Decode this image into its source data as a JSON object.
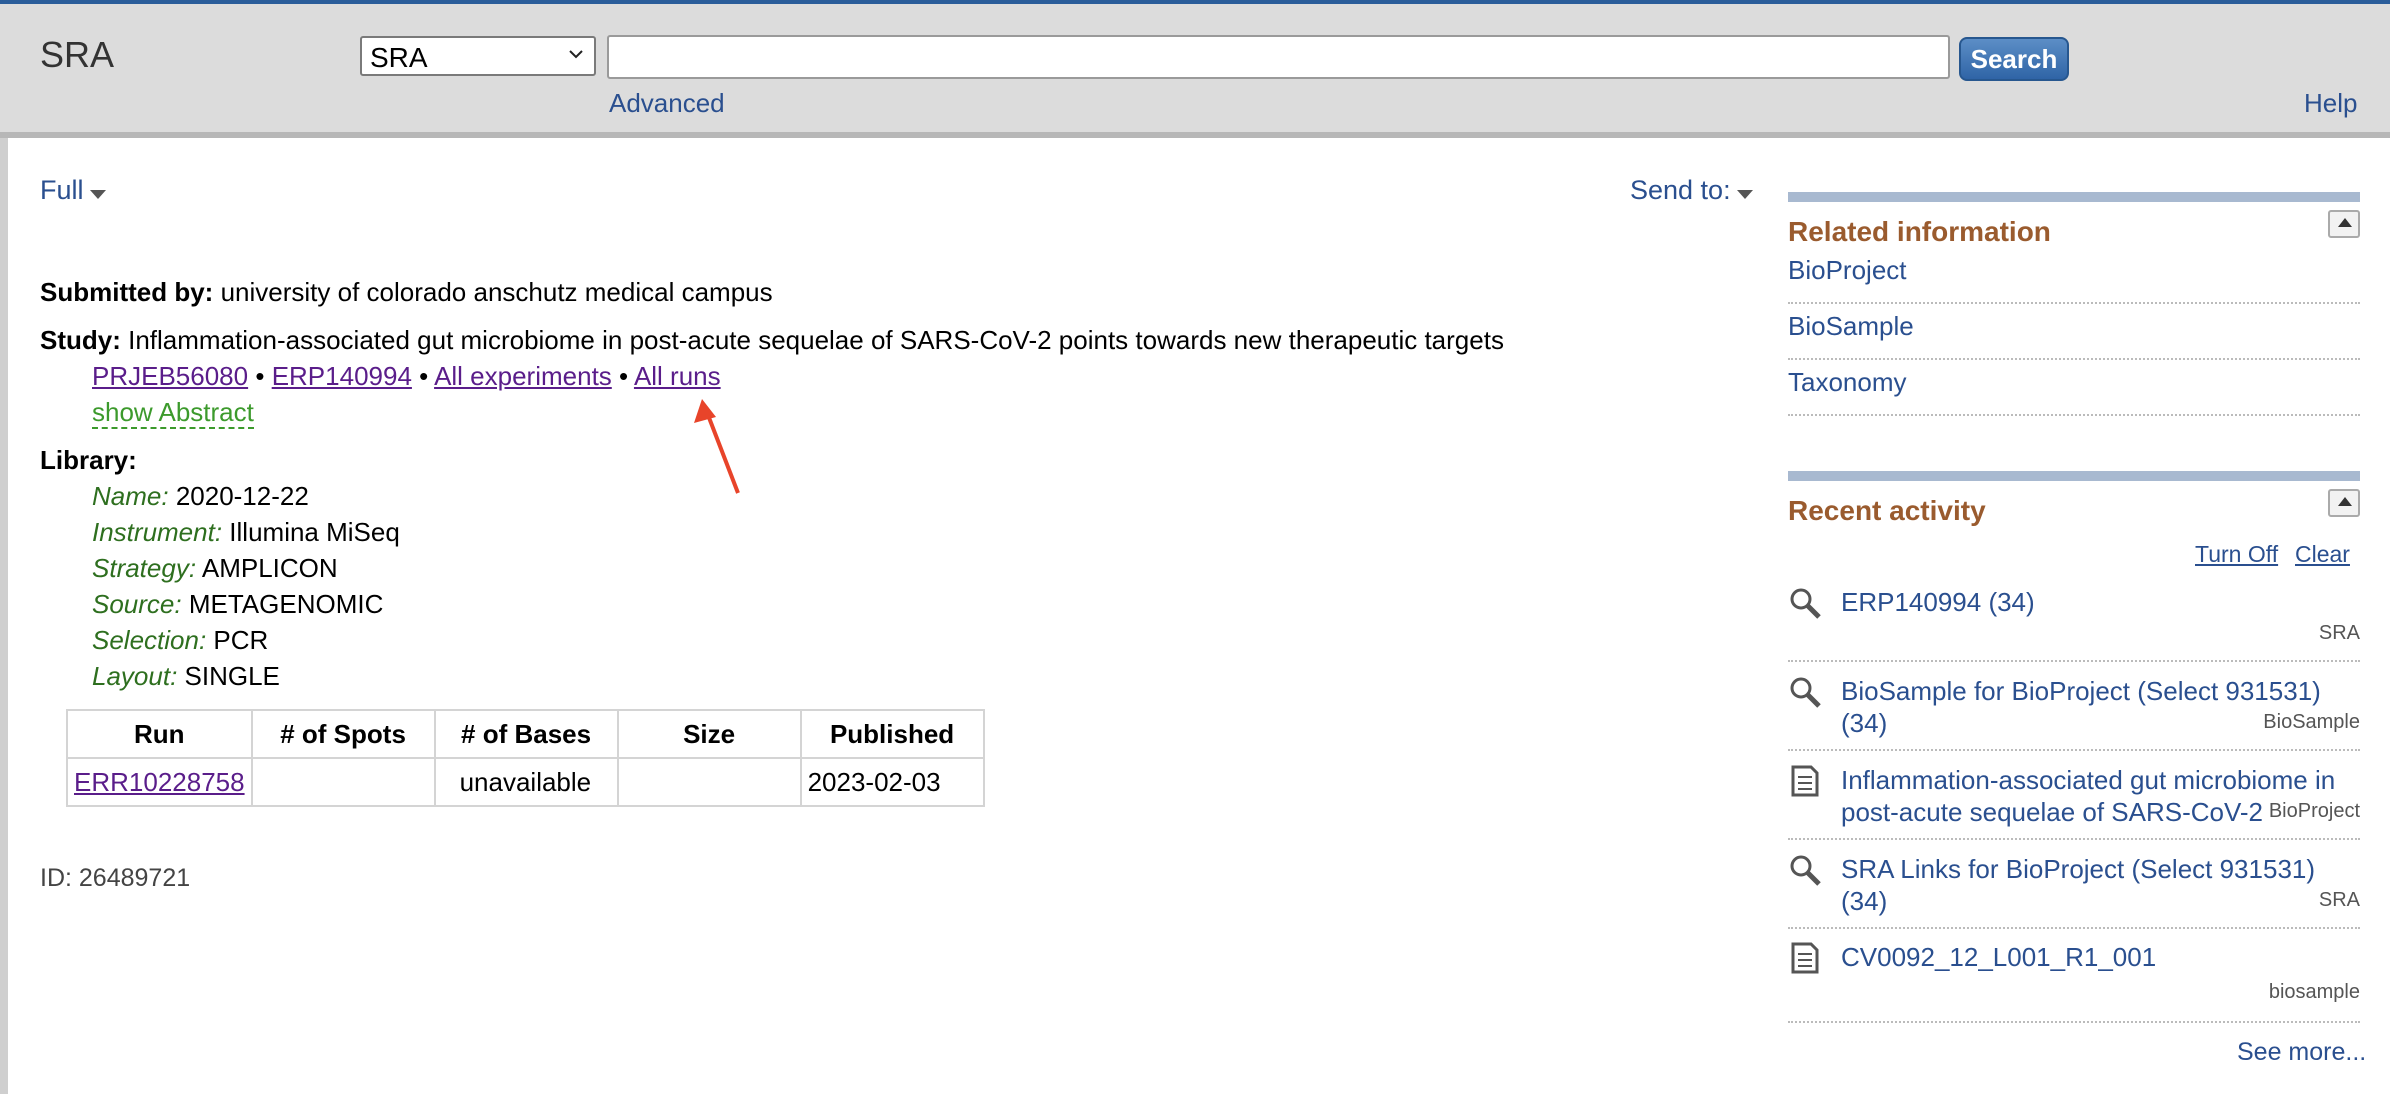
{
  "header": {
    "db_title": "SRA",
    "db_select_value": "SRA",
    "search_value": "",
    "search_button": "Search",
    "advanced": "Advanced",
    "help": "Help"
  },
  "toolbar": {
    "format": "Full",
    "send_to": "Send to:"
  },
  "record": {
    "submitted_label": "Submitted by:",
    "submitted_value": "university of colorado anschutz medical campus",
    "study_label": "Study:",
    "study_value": "Inflammation-associated gut microbiome in post-acute sequelae of SARS-CoV-2 points towards new therapeutic targets",
    "study_links": [
      "PRJEB56080",
      "ERP140994",
      "All experiments",
      "All runs"
    ],
    "bullet": "•",
    "show_abstract": "show Abstract",
    "library_label": "Library:",
    "library": [
      {
        "label": "Name:",
        "value": "2020-12-22"
      },
      {
        "label": "Instrument:",
        "value": "Illumina MiSeq"
      },
      {
        "label": "Strategy:",
        "value": "AMPLICON"
      },
      {
        "label": "Source:",
        "value": "METAGENOMIC"
      },
      {
        "label": "Selection:",
        "value": "PCR"
      },
      {
        "label": "Layout:",
        "value": "SINGLE"
      }
    ],
    "runs_table": {
      "headers": [
        "Run",
        "# of Spots",
        "# of Bases",
        "Size",
        "Published"
      ],
      "rows": [
        [
          "ERR10228758",
          "",
          "unavailable",
          "",
          "2023-02-03"
        ]
      ]
    },
    "id": "ID: 26489721"
  },
  "sidebar": {
    "related_title": "Related information",
    "related": [
      "BioProject",
      "BioSample",
      "Taxonomy"
    ],
    "recent_title": "Recent activity",
    "turn_off": "Turn Off",
    "clear": "Clear",
    "recent": [
      {
        "icon": "search-icon",
        "text1": "ERP140994 (34)",
        "text2": "",
        "db": "SRA"
      },
      {
        "icon": "search-icon",
        "text1": "BioSample for BioProject (Select 931531)",
        "text2": "(34)",
        "db": "BioSample"
      },
      {
        "icon": "document-icon",
        "text1": "Inflammation-associated gut microbiome in",
        "text2": "post-acute sequelae of SARS-CoV-2",
        "db": "BioProject"
      },
      {
        "icon": "search-icon",
        "text1": "SRA Links for BioProject (Select 931531)",
        "text2": "(34)",
        "db": "SRA"
      },
      {
        "icon": "document-icon",
        "text1": "CV0092_12_L001_R1_001",
        "text2": "",
        "db": "biosample"
      }
    ],
    "see_more": "See more..."
  },
  "colors": {
    "link": "#2a4f8f",
    "visited": "#5a1d8a",
    "section_title": "#9a5b2e",
    "arrow": "#e8442a"
  }
}
